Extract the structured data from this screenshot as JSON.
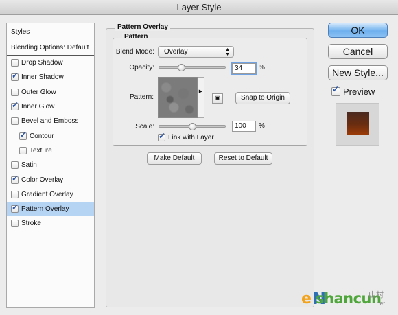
{
  "window": {
    "title": "Layer Style"
  },
  "styles_panel": {
    "header": "Styles",
    "blending_options": "Blending Options: Default",
    "items": [
      {
        "label": "Drop Shadow",
        "checked": false,
        "sub": false,
        "selected": false
      },
      {
        "label": "Inner Shadow",
        "checked": true,
        "sub": false,
        "selected": false
      },
      {
        "label": "Outer Glow",
        "checked": false,
        "sub": false,
        "selected": false
      },
      {
        "label": "Inner Glow",
        "checked": true,
        "sub": false,
        "selected": false
      },
      {
        "label": "Bevel and Emboss",
        "checked": false,
        "sub": false,
        "selected": false
      },
      {
        "label": "Contour",
        "checked": true,
        "sub": true,
        "selected": false
      },
      {
        "label": "Texture",
        "checked": false,
        "sub": true,
        "selected": false
      },
      {
        "label": "Satin",
        "checked": false,
        "sub": false,
        "selected": false
      },
      {
        "label": "Color Overlay",
        "checked": true,
        "sub": false,
        "selected": false
      },
      {
        "label": "Gradient Overlay",
        "checked": false,
        "sub": false,
        "selected": false
      },
      {
        "label": "Pattern Overlay",
        "checked": true,
        "sub": false,
        "selected": true
      },
      {
        "label": "Stroke",
        "checked": false,
        "sub": false,
        "selected": false
      }
    ]
  },
  "pattern_overlay": {
    "group_title": "Pattern Overlay",
    "sub_title": "Pattern",
    "blend_mode_label": "Blend Mode:",
    "blend_mode_value": "Overlay",
    "opacity_label": "Opacity:",
    "opacity_value": "34",
    "opacity_fraction": 0.34,
    "percent": "%",
    "pattern_label": "Pattern:",
    "snap_to_origin": "Snap to Origin",
    "scale_label": "Scale:",
    "scale_value": "100",
    "scale_fraction": 0.5,
    "link_with_layer": "Link with Layer",
    "link_checked": true,
    "make_default": "Make Default",
    "reset_to_default": "Reset to Default"
  },
  "actions": {
    "ok": "OK",
    "cancel": "Cancel",
    "new_style": "New Style...",
    "preview_label": "Preview",
    "preview_checked": true
  },
  "watermark": {
    "e": "e",
    "n": "N",
    "text": "shancun",
    "cn": "山村",
    "net": ".net"
  },
  "colors": {
    "selection": "#b5d3f3",
    "default_button": "#6eb0ee",
    "check": "#2a54a6",
    "preview_swatch": "#6a2d10"
  }
}
